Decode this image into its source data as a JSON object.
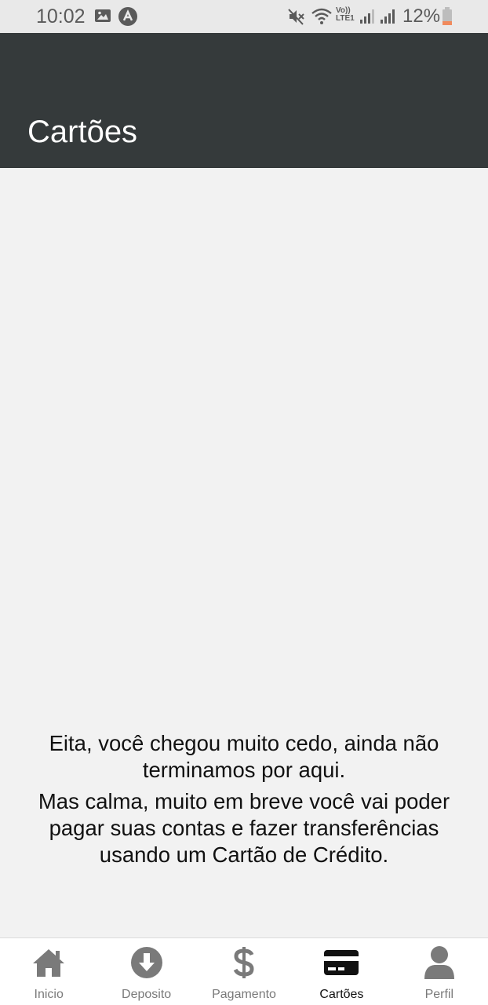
{
  "status_bar": {
    "time": "10:02",
    "battery_percent": "12%",
    "icons": [
      "image-icon",
      "app-notification-icon",
      "mute-icon",
      "wifi-icon",
      "volte-icon",
      "signal-icon",
      "signal-icon",
      "battery-low-icon"
    ],
    "volte_label_top": "Vo))",
    "volte_label_bottom": "LTE1"
  },
  "header": {
    "title": "Cartões",
    "background": "#353a3b"
  },
  "main": {
    "message_line1": "Eita, você chegou muito cedo, ainda não terminamos por aqui.",
    "message_line2": "Mas calma, muito em breve você vai poder pagar suas contas e fazer transferências usando um Cartão de Crédito."
  },
  "bottom_nav": {
    "items": [
      {
        "label": "Inicio",
        "icon": "home-icon",
        "active": false
      },
      {
        "label": "Deposito",
        "icon": "download-circle-icon",
        "active": false
      },
      {
        "label": "Pagamento",
        "icon": "dollar-icon",
        "active": false
      },
      {
        "label": "Cartões",
        "icon": "credit-card-icon",
        "active": true
      },
      {
        "label": "Perfil",
        "icon": "user-icon",
        "active": false
      }
    ],
    "inactive_color": "#7a7a7a",
    "active_color": "#111111"
  }
}
